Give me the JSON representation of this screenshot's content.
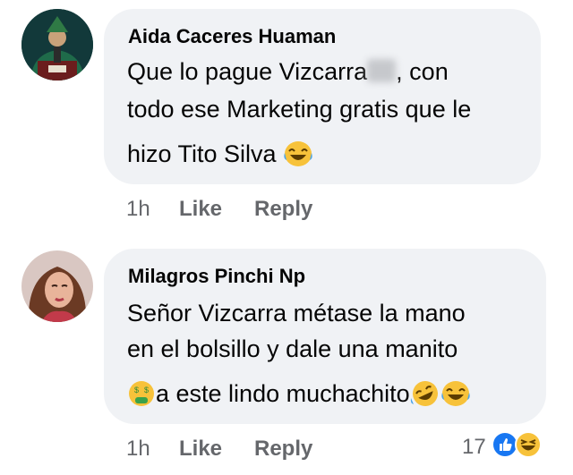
{
  "comments": [
    {
      "author": "Aida Caceres Huaman",
      "lines": [
        "Que lo pague Vizcarra",
        ", con",
        "todo ese Marketing gratis que le",
        "hizo Tito Silva"
      ],
      "time": "1h",
      "like_label": "Like",
      "reply_label": "Reply"
    },
    {
      "author": "Milagros Pinchi Np",
      "lines": [
        "Señor Vizcarra métase la mano",
        "en el bolsillo y dale una manito",
        "a este lindo muchachito"
      ],
      "time": "1h",
      "like_label": "Like",
      "reply_label": "Reply",
      "reaction_count": "17"
    }
  ],
  "colors": {
    "bubble": "#f0f2f5",
    "meta": "#65676b",
    "like_blue": "#1877f2",
    "emoji_yellow": "#f7c23a"
  },
  "icons": [
    "joy-emoji-icon",
    "money-mouth-emoji-icon",
    "rofl-emoji-icon",
    "like-reaction-icon",
    "haha-reaction-icon"
  ]
}
